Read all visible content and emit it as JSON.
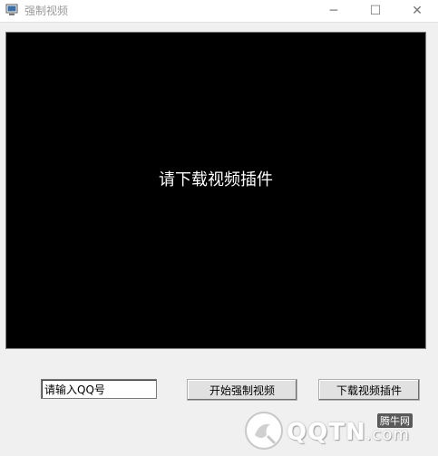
{
  "window": {
    "title": "强制视频",
    "controls": {
      "minimize": "─",
      "maximize": "☐",
      "close": "✕"
    }
  },
  "video": {
    "message": "请下载视频插件",
    "background": "#000000"
  },
  "controls": {
    "qq_input_value": "请输入QQ号",
    "start_button": "开始强制视频",
    "download_button": "下载视频插件"
  },
  "watermark": {
    "brand": "QQTN",
    "tld": ".com",
    "badge": "腾牛网"
  }
}
